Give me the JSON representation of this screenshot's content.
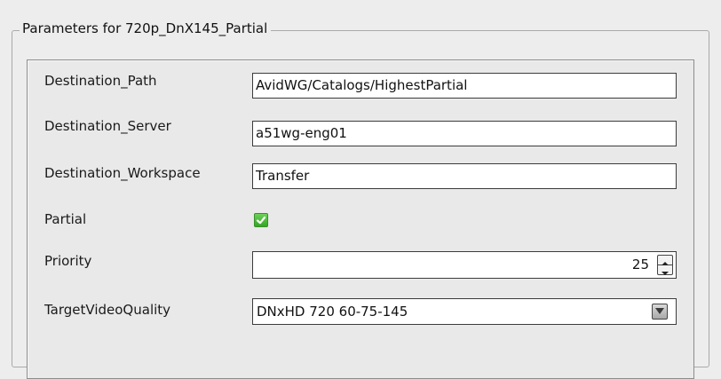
{
  "group": {
    "title": "Parameters for 720p_DnX145_Partial"
  },
  "params": {
    "destination_path": {
      "label": "Destination_Path",
      "value": "AvidWG/Catalogs/HighestPartial"
    },
    "destination_server": {
      "label": "Destination_Server",
      "value": "a51wg-eng01"
    },
    "destination_workspace": {
      "label": "Destination_Workspace",
      "value": "Transfer"
    },
    "partial": {
      "label": "Partial",
      "checked": true
    },
    "priority": {
      "label": "Priority",
      "value": "25"
    },
    "target_video_quality": {
      "label": "TargetVideoQuality",
      "value": "DNxHD 720 60-75-145"
    }
  },
  "icons": {
    "checkbox": "checkmark-icon",
    "spin_up": "arrow-up-icon",
    "spin_down": "arrow-down-icon",
    "dropdown": "chevron-down-icon"
  },
  "colors": {
    "checkbox_green": "#34a524",
    "background": "#ededed"
  }
}
